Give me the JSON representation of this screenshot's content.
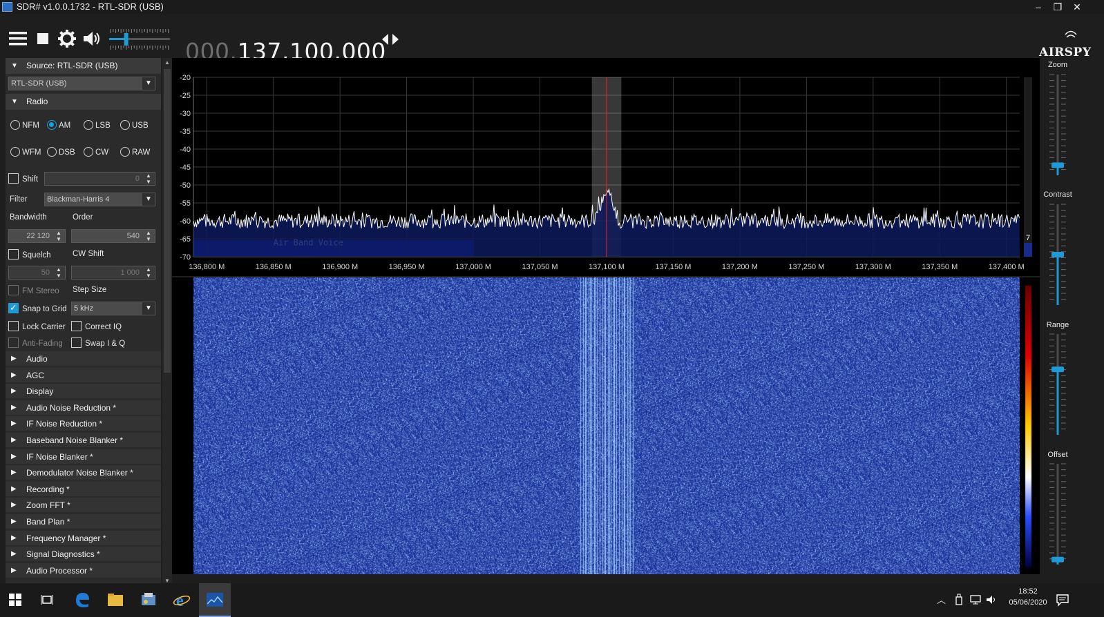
{
  "window": {
    "title": "SDR# v1.0.0.1732 - RTL-SDR (USB)",
    "minimize": "–",
    "restore": "❐",
    "close": "✕"
  },
  "toolbar": {
    "frequency_prefix": "000.",
    "frequency_main": "137.100.000",
    "volume_level": 0.28,
    "brand": "AIRSPY",
    "icons": [
      "menu-icon",
      "stop-icon",
      "gear-icon",
      "speaker-icon",
      "tuning-arrows-icon"
    ]
  },
  "source": {
    "header": "Source: RTL-SDR (USB)",
    "device": "RTL-SDR (USB)"
  },
  "radio": {
    "header": "Radio",
    "modes": [
      {
        "label": "NFM",
        "selected": false
      },
      {
        "label": "AM",
        "selected": true
      },
      {
        "label": "LSB",
        "selected": false
      },
      {
        "label": "USB",
        "selected": false
      },
      {
        "label": "WFM",
        "selected": false
      },
      {
        "label": "DSB",
        "selected": false
      },
      {
        "label": "CW",
        "selected": false
      },
      {
        "label": "RAW",
        "selected": false
      }
    ],
    "shift_label": "Shift",
    "shift_value": "0",
    "filter_label": "Filter",
    "filter_value": "Blackman-Harris 4",
    "bandwidth_label": "Bandwidth",
    "bandwidth_value": "22 120",
    "order_label": "Order",
    "order_value": "540",
    "squelch_label": "Squelch",
    "squelch_value": "50",
    "cw_shift_label": "CW Shift",
    "cw_shift_value": "1 000",
    "fm_stereo_label": "FM Stereo",
    "step_size_label": "Step Size",
    "snap_to_grid_label": "Snap to Grid",
    "step_size_value": "5 kHz",
    "lock_carrier_label": "Lock Carrier",
    "correct_iq_label": "Correct IQ",
    "anti_fading_label": "Anti-Fading",
    "swap_iq_label": "Swap I & Q"
  },
  "plugins": [
    "Audio",
    "AGC",
    "Display",
    "Audio Noise Reduction *",
    "IF Noise Reduction *",
    "Baseband Noise Blanker *",
    "IF Noise Blanker *",
    "Demodulator Noise Blanker *",
    "Recording *",
    "Zoom FFT *",
    "Band Plan *",
    "Frequency Manager *",
    "Signal Diagnostics *",
    "Audio Processor *"
  ],
  "spectrum": {
    "y_ticks": [
      "-20",
      "-25",
      "-30",
      "-35",
      "-40",
      "-45",
      "-50",
      "-55",
      "-60",
      "-65",
      "-70"
    ],
    "x_ticks": [
      "136,800 M",
      "136,850 M",
      "136,900 M",
      "136,950 M",
      "137,000 M",
      "137,050 M",
      "137,100 M",
      "137,150 M",
      "137,200 M",
      "137,250 M",
      "137,300 M",
      "137,350 M",
      "137,400 M"
    ],
    "band_label": "Air Band Voice",
    "ymin": -70,
    "ymax": -20,
    "fmin": 136.79,
    "fmax": 137.41,
    "center_freq": 137.1,
    "bandwidth_mhz": 0.02212,
    "noise_floor_db": -60,
    "band_start": 136.79,
    "band_end": 137.0,
    "side_value": "7",
    "colors": {
      "trace": "#ffffff",
      "fill": "#0c1a5a",
      "band": "#0a1fb8",
      "center_line": "#ff2020"
    }
  },
  "right_panel": {
    "zoom_label": "Zoom",
    "contrast_label": "Contrast",
    "range_label": "Range",
    "offset_label": "Offset",
    "zoom_level": 0.1,
    "contrast_level": 0.5,
    "range_level": 0.65,
    "offset_level": 0.05
  },
  "taskbar": {
    "time": "18:52",
    "date": "05/06/2020",
    "icons": [
      "windows-start-icon",
      "task-view-icon",
      "edge-icon",
      "file-explorer-icon",
      "control-panel-icon",
      "internet-explorer-icon",
      "sdrsharp-icon"
    ]
  }
}
